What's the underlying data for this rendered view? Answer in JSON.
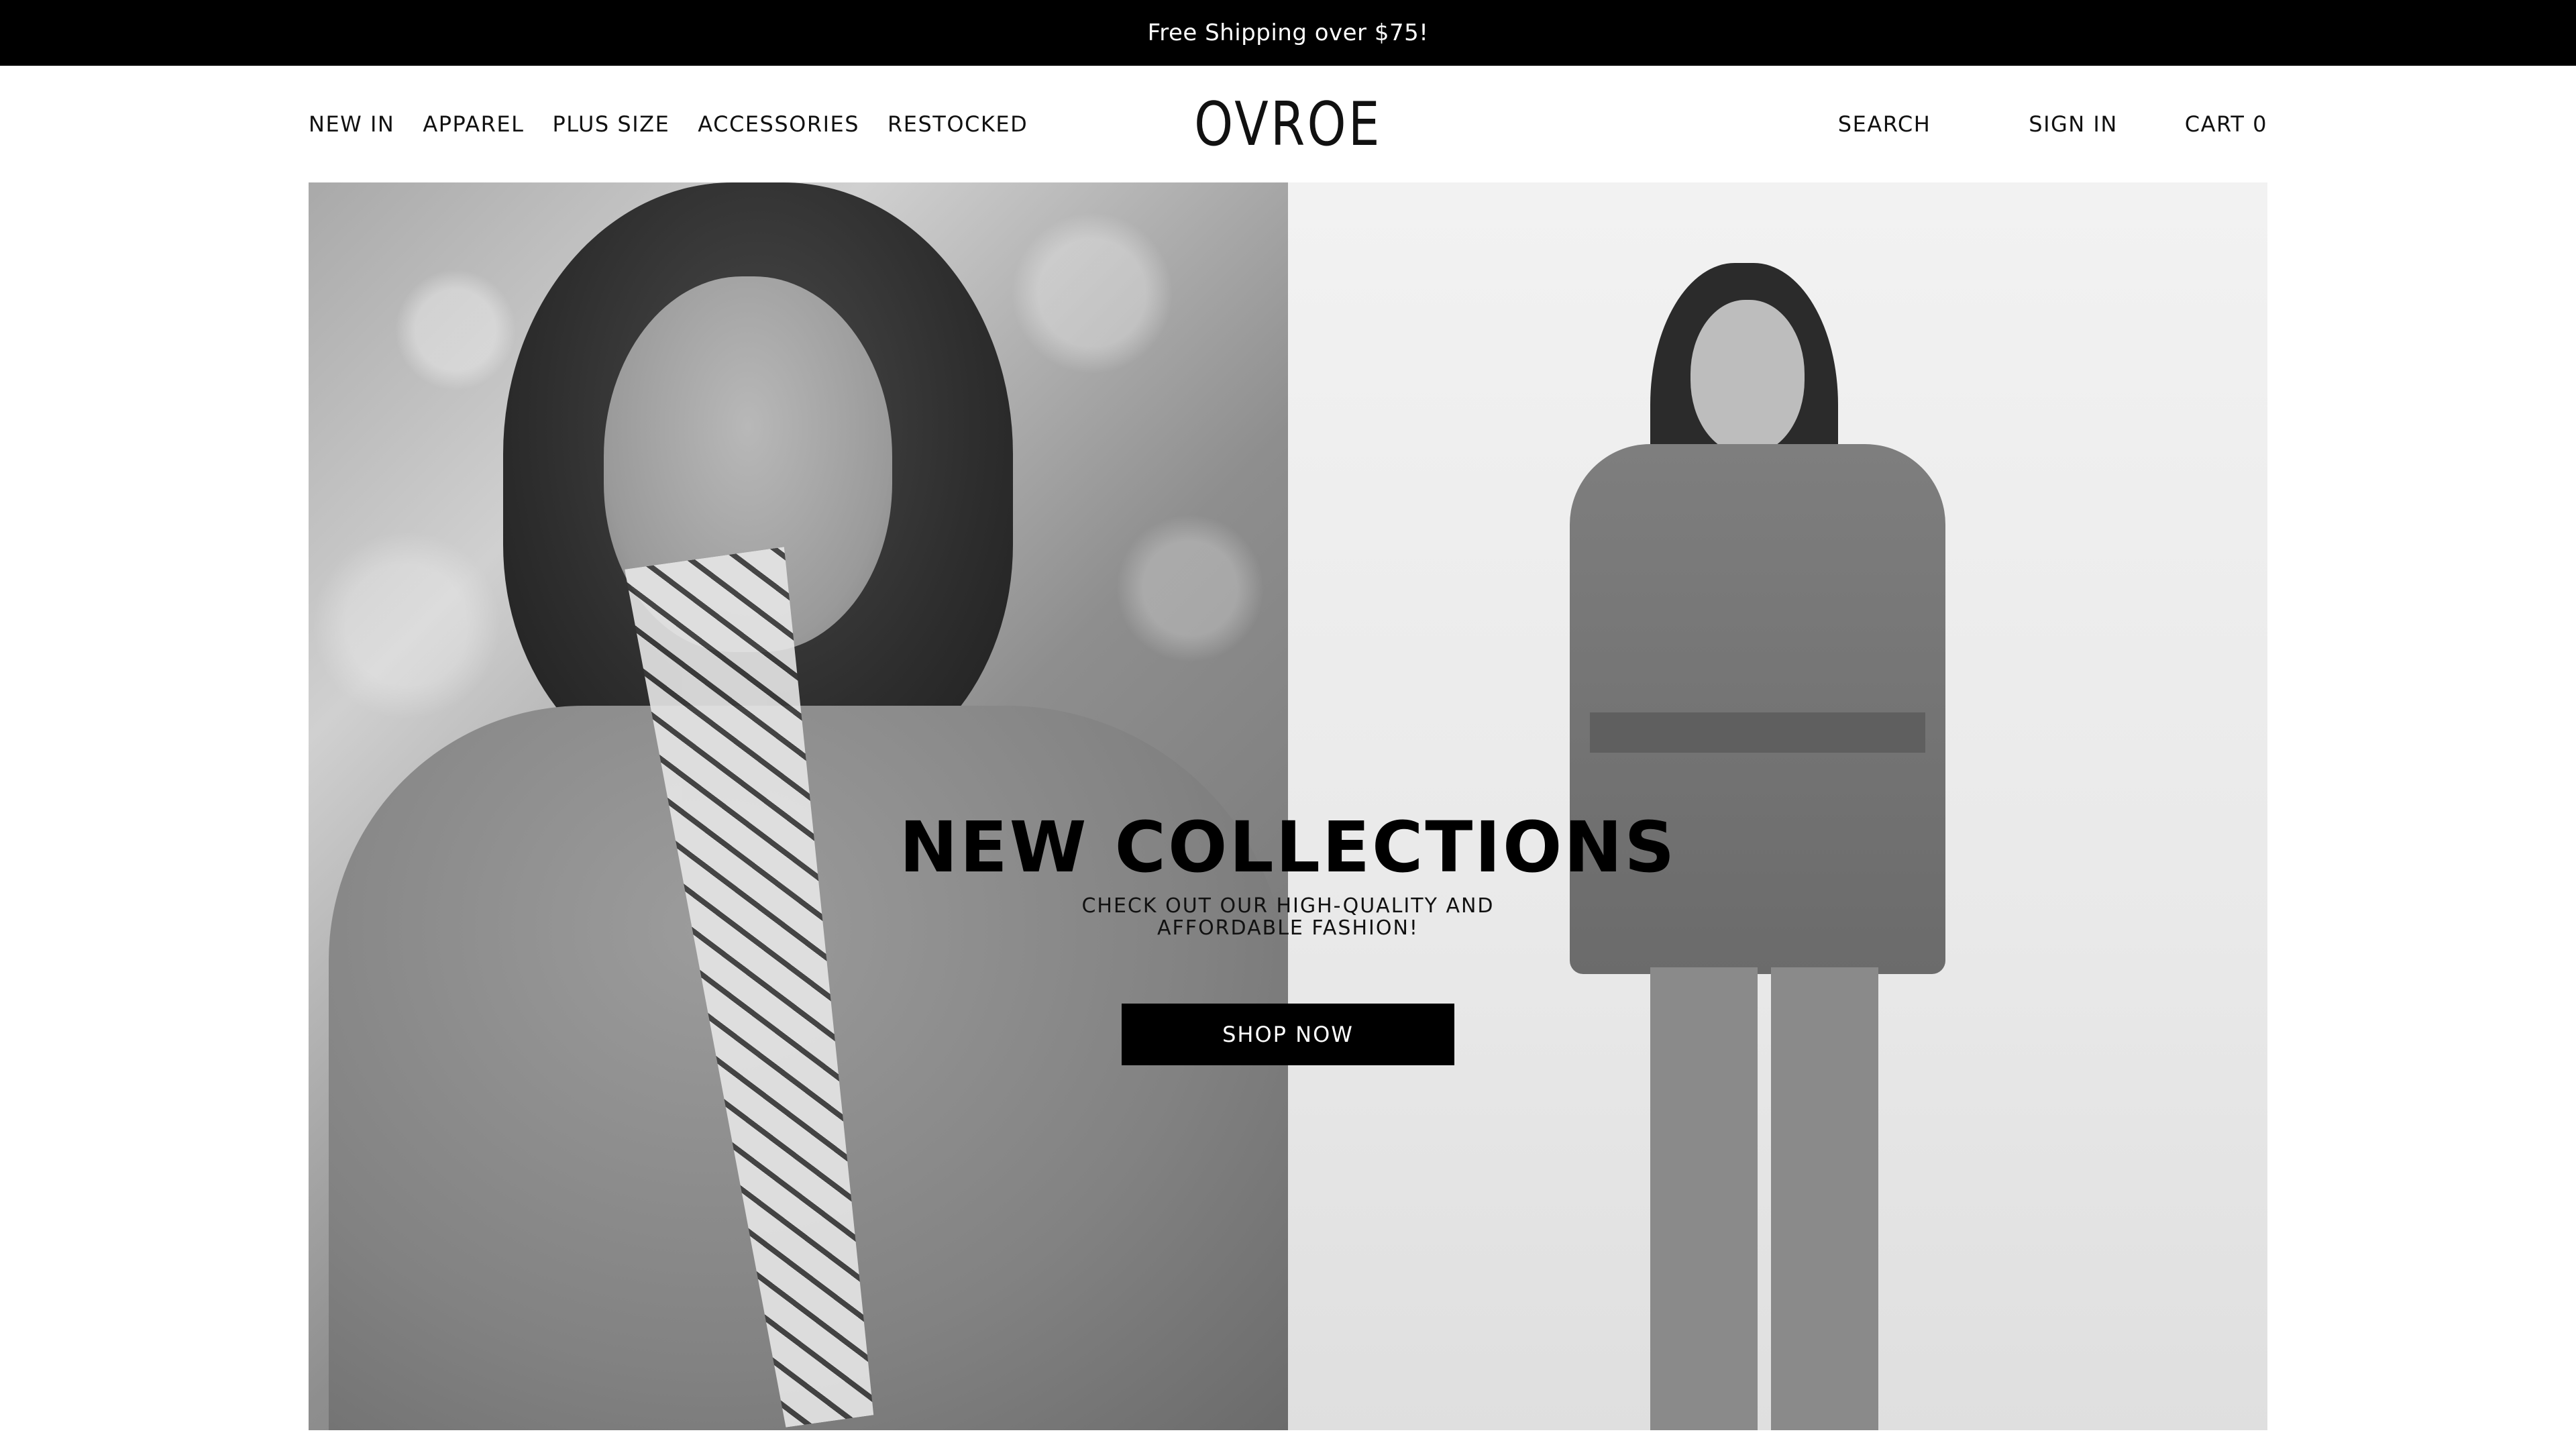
{
  "announcement": {
    "text": "Free Shipping over $75!"
  },
  "nav": {
    "left": [
      "NEW IN",
      "APPAREL",
      "PLUS SIZE",
      "ACCESSORIES",
      "RESTOCKED"
    ],
    "logo": "OVROE",
    "search": "SEARCH",
    "sign_in": "SIGN IN",
    "cart": "CART 0"
  },
  "hero": {
    "title": "NEW COLLECTIONS",
    "subtitle": "CHECK OUT OUR HIGH-QUALITY AND AFFORDABLE FASHION!",
    "cta": "SHOP NOW"
  },
  "colors": {
    "announcement_bg": "#000000",
    "cta_bg": "#000000",
    "text": "#111111"
  }
}
